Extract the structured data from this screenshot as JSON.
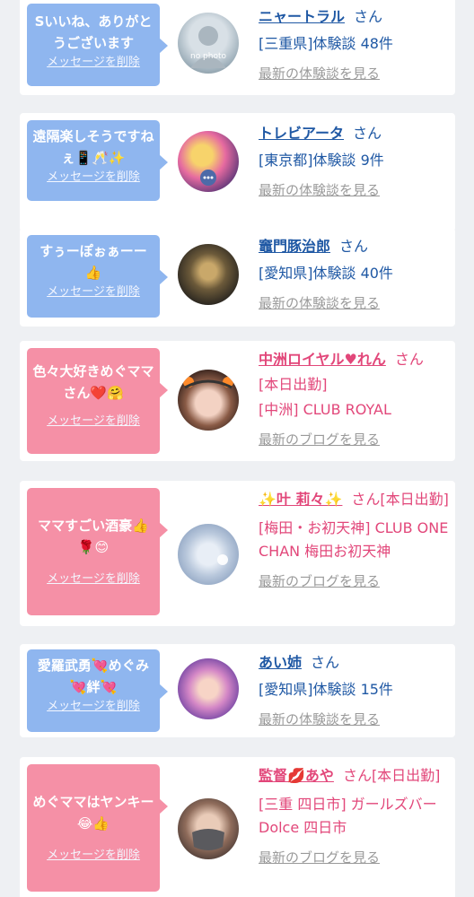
{
  "cards": [
    {
      "message": "Sいいね、ありがとうございます",
      "delete_label": "メッセージを削除",
      "name": "ニャートラル",
      "honorific": "さん",
      "detail1": "[三重県]体験談 48件",
      "detail2": "",
      "link": "最新の体験談を見る",
      "avatar_text": "no photo"
    },
    {
      "message": "遠隔楽しそうですねぇ📱🥂✨",
      "delete_label": "メッセージを削除",
      "name": "トレビアータ",
      "honorific": "さん",
      "detail1": "[東京都]体験談 9件",
      "detail2": "",
      "link": "最新の体験談を見る"
    },
    {
      "message": "すぅーぽぉぁーー👍",
      "delete_label": "メッセージを削除",
      "name": "竈門豚治郎",
      "honorific": "さん",
      "detail1": "[愛知県]体験談 40件",
      "detail2": "",
      "link": "最新の体験談を見る"
    },
    {
      "message": "色々大好きめぐママさん❤️🤗",
      "delete_label": "メッセージを削除",
      "name": "中洲ロイヤル♥れん",
      "honorific": "さん",
      "detail1": "[本日出勤]",
      "detail2": "[中洲] CLUB ROYAL",
      "link": "最新のブログを見る"
    },
    {
      "message": "ママすごい酒豪👍🌹😊",
      "delete_label": "メッセージを削除",
      "name": "✨叶 莉々✨",
      "honorific": "さん[本日出勤]",
      "detail1": "[梅田・お初天神] CLUB ONE CHAN 梅田お初天神",
      "detail2": "",
      "link": "最新のブログを見る"
    },
    {
      "message": "愛羅武勇💘めぐみ💘絆💘",
      "delete_label": "メッセージを削除",
      "name": "あい姉",
      "honorific": "さん",
      "detail1": "[愛知県]体験談 15件",
      "detail2": "",
      "link": "最新の体験談を見る"
    },
    {
      "message": "めぐママはヤンキー😂👍",
      "delete_label": "メッセージを削除",
      "name": "監督💋あや",
      "honorific": "さん[本日出勤]",
      "detail1": "[三重 四日市] ガールズバー Dolce 四日市",
      "detail2": "",
      "link": "最新のブログを見る"
    }
  ],
  "colors": {
    "blue_bubble": "#8fb6ef",
    "pink_bubble": "#f590a6",
    "blue_text": "#1f58a4",
    "pink_text": "#e2477a"
  }
}
